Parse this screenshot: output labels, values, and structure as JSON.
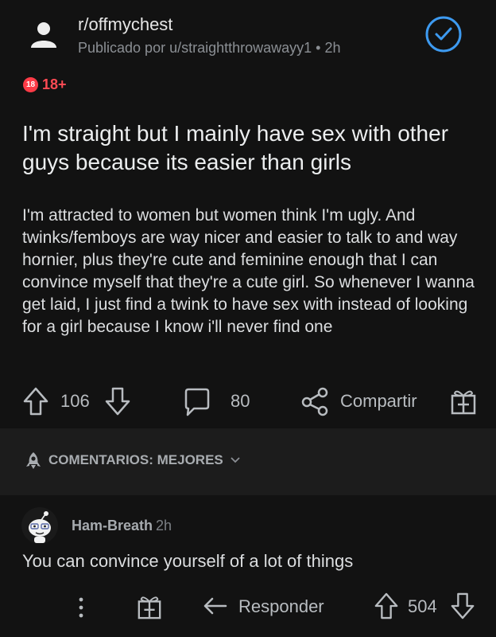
{
  "post": {
    "subreddit": "r/offmychest",
    "meta": "Publicado por u/straightthrowawayy1 • 2h",
    "nsfw_badge": "18",
    "nsfw_label": "18+",
    "title": "I'm straight but I mainly have sex with other guys because its easier than girls",
    "body": "I'm attracted to women but women think I'm ugly. And twinks/femboys are way nicer and easier to talk to and way hornier, plus they're cute and feminine enough that I can convince myself that they're a cute girl. So whenever I wanna get laid, I just find a twink to have sex with instead of looking for a girl because I know i'll never find one",
    "votes": "106",
    "comments": "80",
    "share_label": "Compartir"
  },
  "sort": {
    "label": "COMENTARIOS: MEJORES"
  },
  "comment": {
    "username": "Ham-Breath",
    "time": "2h",
    "text": "You can convince yourself of a lot of things",
    "reply_label": "Responder",
    "votes": "504"
  },
  "colors": {
    "background": "#121212",
    "nsfw": "#ff3b47",
    "accent": "#3d9af0"
  }
}
